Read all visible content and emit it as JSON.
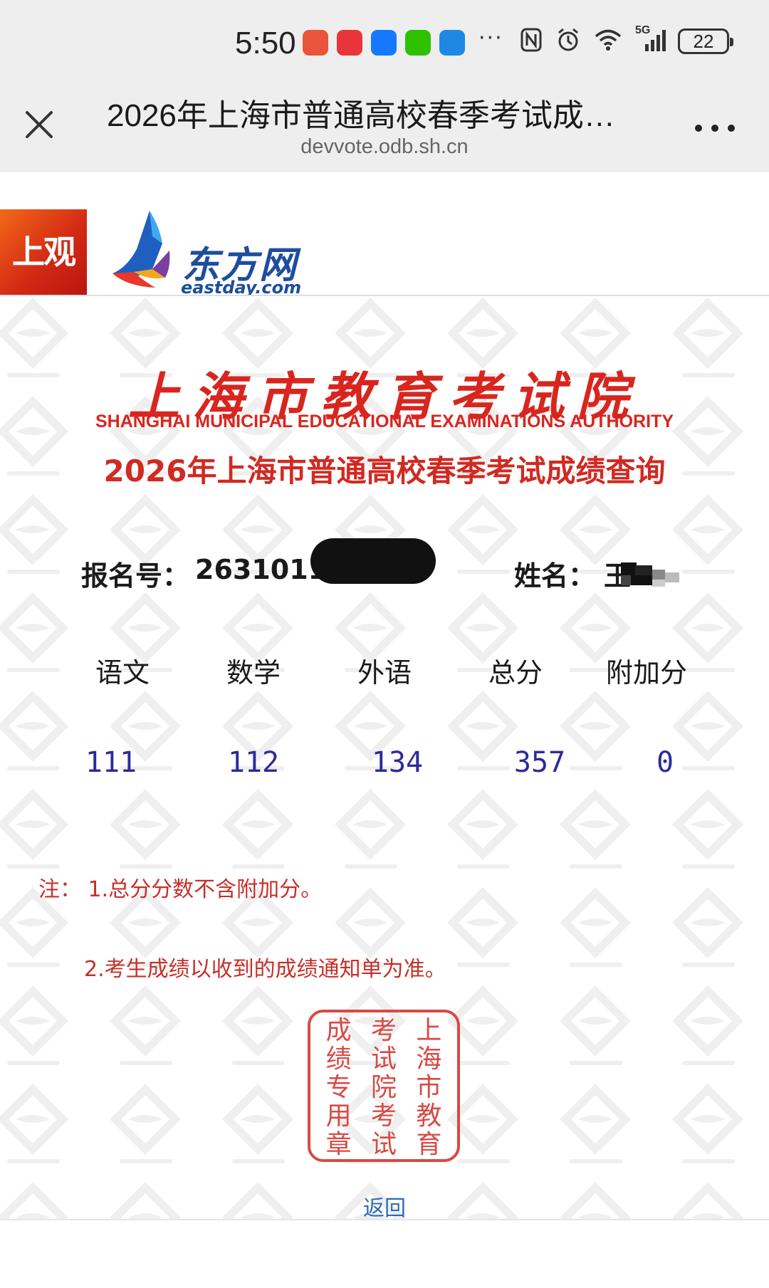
{
  "status_bar": {
    "time": "5:50",
    "notification_icons": [
      {
        "name": "missed-call-icon",
        "color": "#e8553a"
      },
      {
        "name": "huawei-app-icon",
        "color": "#e8353a"
      },
      {
        "name": "alipay-icon",
        "color": "#1677ff"
      },
      {
        "name": "wechat-icon",
        "color": "#2dc100"
      },
      {
        "name": "weather-icon",
        "color": "#1e88e5"
      }
    ],
    "more": "···",
    "network": "5G",
    "battery": "22"
  },
  "browser": {
    "title": "2026年上海市普通高校春季考试成…",
    "url": "devvote.odb.sh.cn"
  },
  "logos": {
    "shangguan": "上观",
    "eastday_cn": "东方网",
    "eastday_en": "eastday.com"
  },
  "page": {
    "org_cn": "上海市教育考试院",
    "org_en": "SHANGHAI MUNICIPAL EDUCATIONAL EXAMINATIONS AUTHORITY",
    "title": "2026年上海市普通高校春季考试成绩查询",
    "reg_label": "报名号：",
    "reg_value": "2631011",
    "name_label": "姓名：",
    "name_value": "王",
    "score_headers": [
      "语文",
      "数学",
      "外语",
      "总分",
      "附加分"
    ],
    "score_values": [
      "111",
      "112",
      "134",
      "357",
      "0"
    ],
    "note1": "注：  1.总分分数不含附加分。",
    "note2": "2.考生成绩以收到的成绩通知单为准。",
    "seal_columns": [
      [
        "上",
        "海",
        "市",
        "教",
        "育"
      ],
      [
        "考",
        "试",
        "院",
        "考",
        "试"
      ],
      [
        "成",
        "绩",
        "专",
        "用",
        "章"
      ]
    ],
    "back": "返回"
  },
  "colors": {
    "accent_red": "#d8261f",
    "score_blue": "#2b2b9c",
    "link_blue": "#2f6ab3",
    "eastday_blue": "#1d4e9e"
  }
}
